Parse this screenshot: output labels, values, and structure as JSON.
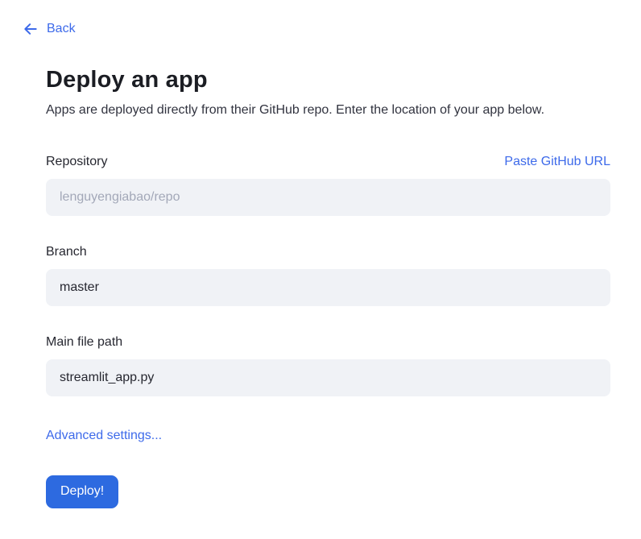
{
  "back": {
    "label": "Back",
    "icon": "arrow-left"
  },
  "page": {
    "title": "Deploy an app",
    "subtitle": "Apps are deployed directly from their GitHub repo. Enter the location of your app below."
  },
  "form": {
    "repository": {
      "label": "Repository",
      "paste_link": "Paste GitHub URL",
      "placeholder": "lenguyengiabao/repo",
      "value": ""
    },
    "branch": {
      "label": "Branch",
      "value": "master"
    },
    "main_file": {
      "label": "Main file path",
      "value": "streamlit_app.py"
    },
    "advanced_link": "Advanced settings...",
    "deploy_button": "Deploy!"
  },
  "colors": {
    "accent_link": "#3d6aea",
    "button_background": "#2d6ae0",
    "button_text": "#ffffff",
    "input_background": "#f0f2f6",
    "placeholder_text": "#a3a8b8",
    "heading_text": "#1b1d23",
    "body_text": "#31333f"
  }
}
